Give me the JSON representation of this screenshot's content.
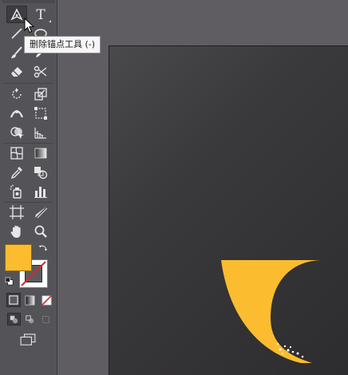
{
  "tooltip": {
    "text": "删除锚点工具 (-)"
  },
  "toolbar": {
    "fill_color": "#fbbd2f",
    "stroke_color": "#ffffff",
    "accent_none": "#d42a2a",
    "tools": [
      {
        "name": "pen-tool",
        "icon": "pen-icon",
        "active": true
      },
      {
        "name": "type-tool",
        "icon": "type-icon",
        "label": "T"
      },
      {
        "name": "line-segment-tool",
        "icon": "line-icon"
      },
      {
        "name": "ellipse-tool",
        "icon": "ellipse-icon"
      },
      {
        "name": "paintbrush-tool",
        "icon": "brush-icon"
      },
      {
        "name": "pencil-tool",
        "icon": "pencil-icon"
      },
      {
        "name": "eraser-tool",
        "icon": "eraser-icon"
      },
      {
        "name": "scissors-tool",
        "icon": "scissors-icon"
      },
      {
        "name": "rotate-tool",
        "icon": "rotate-icon"
      },
      {
        "name": "scale-tool",
        "icon": "scale-icon"
      },
      {
        "name": "width-tool",
        "icon": "width-icon"
      },
      {
        "name": "free-transform-tool",
        "icon": "free-transform-icon"
      },
      {
        "name": "shape-builder-tool",
        "icon": "shape-builder-icon"
      },
      {
        "name": "perspective-grid-tool",
        "icon": "perspective-grid-icon"
      },
      {
        "name": "mesh-tool",
        "icon": "mesh-icon"
      },
      {
        "name": "gradient-tool",
        "icon": "gradient-icon"
      },
      {
        "name": "eyedropper-tool",
        "icon": "eyedropper-icon"
      },
      {
        "name": "blend-tool",
        "icon": "blend-icon"
      },
      {
        "name": "symbol-sprayer-tool",
        "icon": "symbol-sprayer-icon"
      },
      {
        "name": "column-graph-tool",
        "icon": "column-graph-icon"
      },
      {
        "name": "artboard-tool",
        "icon": "artboard-icon"
      },
      {
        "name": "slice-tool",
        "icon": "slice-icon"
      },
      {
        "name": "hand-tool",
        "icon": "hand-icon"
      },
      {
        "name": "zoom-tool",
        "icon": "zoom-icon"
      }
    ],
    "swap_icon": "swap-arrow-icon",
    "default_colors_icon": "default-colors-icon",
    "color_modes": [
      "color-icon",
      "gradient-mode-icon",
      "none-icon"
    ],
    "draw_modes": [
      "draw-normal-icon",
      "draw-behind-icon",
      "draw-inside-icon"
    ],
    "screen_mode_icon": "screen-mode-icon"
  },
  "artboard": {
    "shape_color": "#fbbd2f",
    "shape": "crescent"
  }
}
